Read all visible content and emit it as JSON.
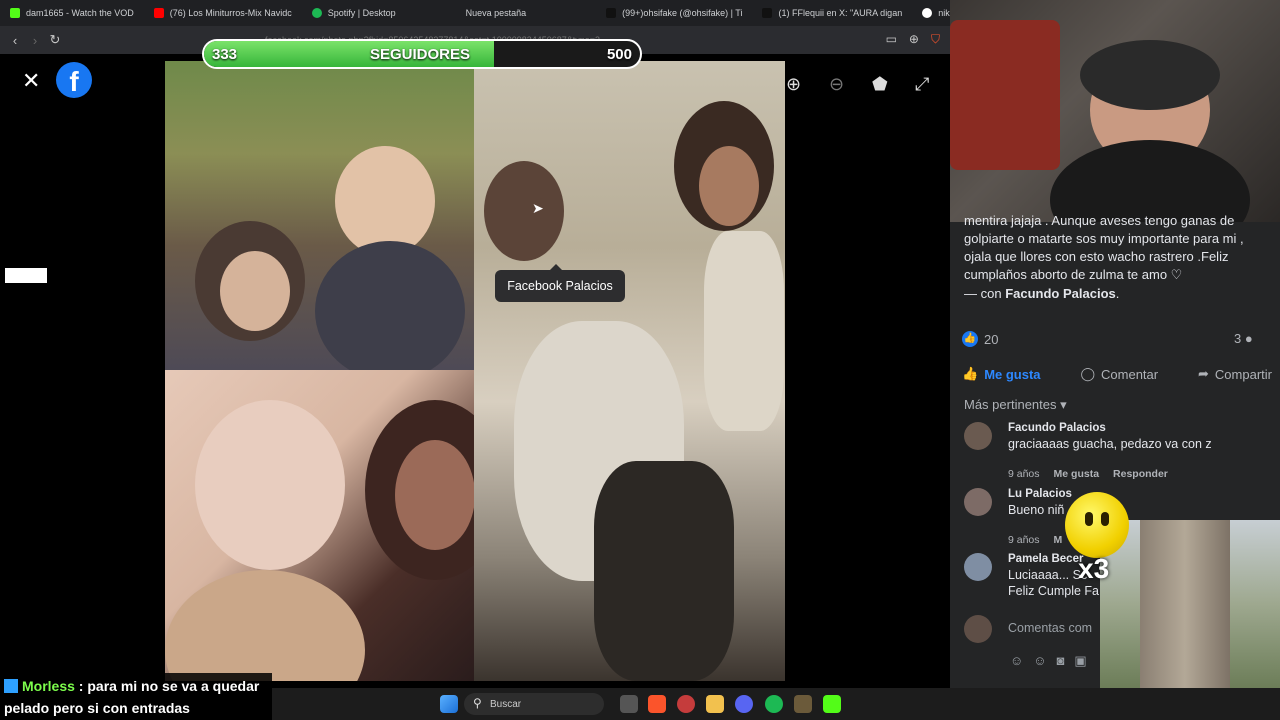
{
  "browser": {
    "tabs": [
      {
        "label": "dam1665 - Watch the VOD",
        "color": "#53fc18"
      },
      {
        "label": "(76) Los Miniturros-Mix Navidc",
        "color": "#ff0000"
      },
      {
        "label": "Spotify | Desktop",
        "color": "#1db954"
      },
      {
        "label": "Nueva pestaña",
        "color": "#2b2c30"
      },
      {
        "label": "(99+)ohsifake (@ohsifake) | Ti",
        "color": "#111111"
      },
      {
        "label": "(1) FFlequii en X: \"AURA digan",
        "color": "#111111"
      },
      {
        "label": "nike 2011 - Buscar c",
        "color": "#ffffff"
      }
    ],
    "url": "facebook.com/photo.php?fbid=850643548377814&set=t.100009834450687&type=3"
  },
  "followers_bar": {
    "current": "333",
    "label": "SEGUIDORES",
    "goal": "500",
    "progress": 0.666
  },
  "viewer": {
    "tag_tooltip": "Facebook Palacios"
  },
  "post": {
    "caption": "mentira jajaja . Aunque aveses tengo ganas de golpiarte o matarte sos muy importante para mi , ojala que llores con esto wacho rastrero .Feliz cumplaños aborto de zulma te amo ♡",
    "with_prefix": "— con",
    "with_name": "Facundo Palacios",
    "with_suffix": ".",
    "like_count": "20",
    "comment_count": "3",
    "actions": {
      "like": "Me gusta",
      "comment": "Comentar",
      "share": "Compartir"
    },
    "sort_label": "Más pertinentes"
  },
  "comments": [
    {
      "name": "Facundo Palacios",
      "text": "graciaaaas guacha, pedazo va con z",
      "time": "9 años",
      "like": "Me gusta",
      "reply": "Responder"
    },
    {
      "name": "Lu Palacios",
      "text": "Bueno niñ",
      "time": "9 años",
      "like": "M"
    },
    {
      "name": "Pamela Becer",
      "text": "Luciaaaa... Sc",
      "text2": "Feliz Cumple Fa"
    }
  ],
  "compose_placeholder": "Comentas com",
  "overlay": {
    "multiplier": "x3"
  },
  "chat": {
    "user": "Morless",
    "message": " : para mi no se va a quedar pelado pero si con entradas"
  },
  "taskbar": {
    "search": "Buscar"
  }
}
